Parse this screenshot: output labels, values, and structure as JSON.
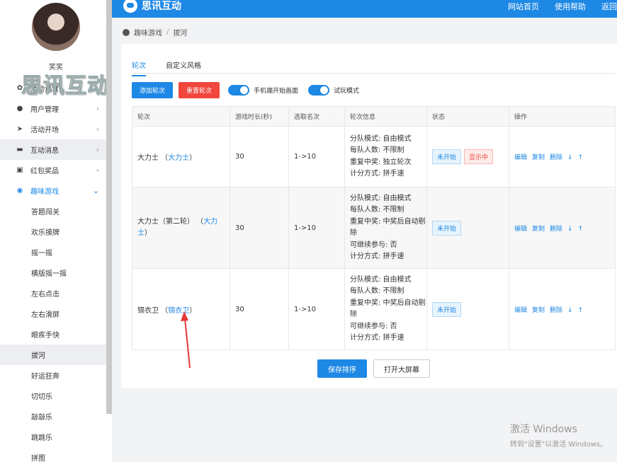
{
  "user": {
    "name": "笑笑"
  },
  "watermark": "思讯互动",
  "menu": [
    {
      "label": "活动设置",
      "icon": "gear-icon"
    },
    {
      "label": "用户管理",
      "icon": "user-icon"
    },
    {
      "label": "活动开场",
      "icon": "send-icon"
    },
    {
      "label": "互动消息",
      "icon": "chat-icon"
    },
    {
      "label": "红包奖品",
      "icon": "gift-icon"
    },
    {
      "label": "趣味游戏",
      "icon": "game-icon"
    }
  ],
  "submenu": [
    "答题闯关",
    "欢乐摸牌",
    "摇一摇",
    "横版摇一摇",
    "左右点击",
    "左右滑屏",
    "眼疾手快",
    "拔河",
    "好运狂奔",
    "切切乐",
    "敲敲乐",
    "跳跳乐",
    "拼图"
  ],
  "topbar": {
    "brand": "思讯互动",
    "links": [
      "网站首页",
      "使用帮助",
      "返回"
    ]
  },
  "breadcrumb": {
    "parent": "趣味游戏",
    "current": "拔河"
  },
  "tabs": [
    "轮次",
    "自定义风格"
  ],
  "buttons": {
    "add": "添加轮次",
    "reset": "重置轮次"
  },
  "toggles": [
    "手机端开始画面",
    "试玩模式"
  ],
  "table": {
    "headers": [
      "轮次",
      "游戏时长(秒)",
      "选取名次",
      "轮次信息",
      "状态",
      "操作"
    ],
    "rows": [
      {
        "name": "大力士",
        "alias": "大力士",
        "duration": "30",
        "rank": "1->10",
        "info": [
          "分队模式: 自由模式",
          "每队人数: 不限制",
          "重复中奖: 独立轮次",
          "计分方式: 拼手速"
        ],
        "status": [
          "未开始",
          "显示中"
        ]
      },
      {
        "name": "大力士（第二轮）",
        "alias": "大力士",
        "duration": "30",
        "rank": "1->10",
        "info": [
          "分队模式: 自由模式",
          "每队人数: 不限制",
          "重复中奖: 中奖后自动剔除",
          "可继续参与: 否",
          "计分方式: 拼手速"
        ],
        "status": [
          "未开始"
        ]
      },
      {
        "name": "锦衣卫",
        "alias": "锦衣卫",
        "duration": "30",
        "rank": "1->10",
        "info": [
          "分队模式: 自由模式",
          "每队人数: 不限制",
          "重复中奖: 中奖后自动剔除",
          "可继续参与: 否",
          "计分方式: 拼手速"
        ],
        "status": [
          "未开始"
        ]
      }
    ],
    "ops": [
      "编辑",
      "复制",
      "删除",
      "↓",
      "↑"
    ]
  },
  "footer_buttons": {
    "save": "保存排序",
    "open": "打开大屏幕"
  },
  "windows_notice": {
    "title": "激活 Windows",
    "sub": "转到\"设置\"以激活 Windows。"
  },
  "colors": {
    "accent": "#1e88e5",
    "danger": "#f0463c"
  }
}
